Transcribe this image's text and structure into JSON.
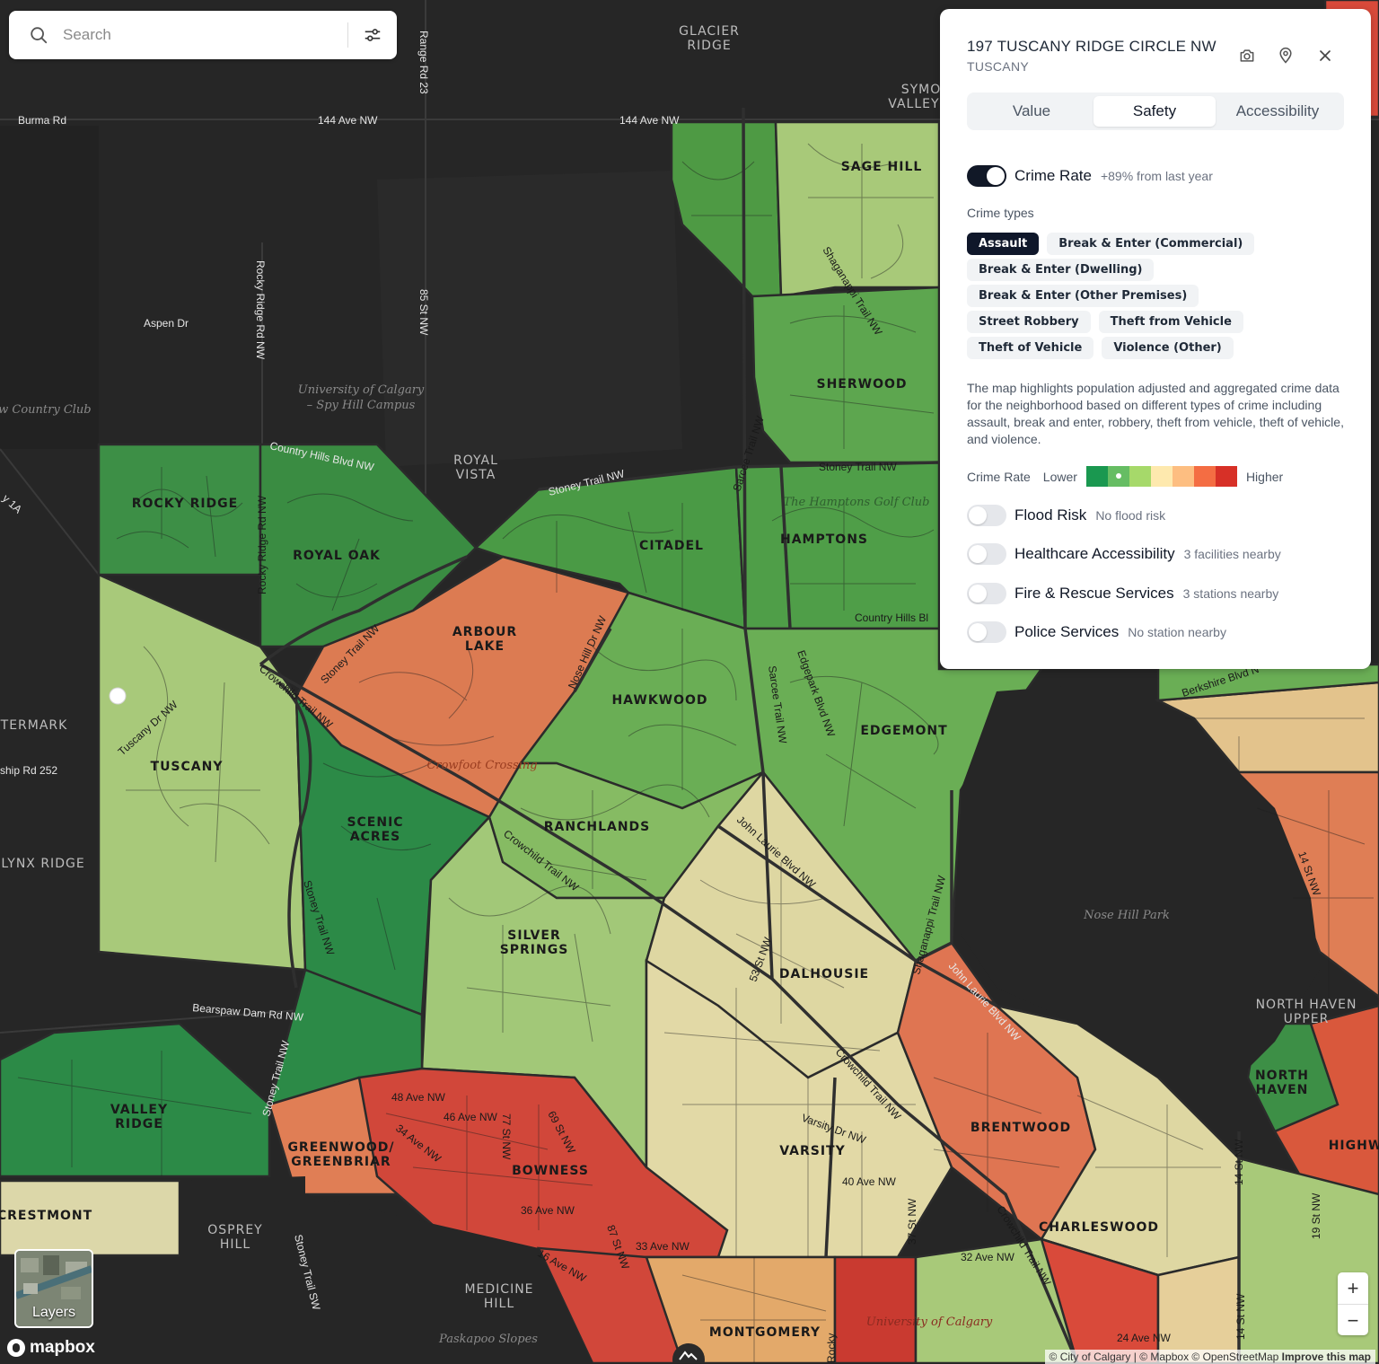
{
  "search": {
    "placeholder": "Search"
  },
  "panel": {
    "address": "197 TUSCANY RIDGE CIRCLE NW",
    "neighborhood": "TUSCANY",
    "tabs": [
      "Value",
      "Safety",
      "Accessibility"
    ],
    "active_tab": "Safety",
    "crime_rate": {
      "label": "Crime Rate",
      "note": "+89% from last year",
      "enabled": true
    },
    "crime_types_title": "Crime types",
    "crime_types": [
      {
        "label": "Assault",
        "selected": true
      },
      {
        "label": "Break & Enter (Commercial)",
        "selected": false
      },
      {
        "label": "Break & Enter (Dwelling)",
        "selected": false
      },
      {
        "label": "Break & Enter (Other Premises)",
        "selected": false
      },
      {
        "label": "Street Robbery",
        "selected": false
      },
      {
        "label": "Theft from Vehicle",
        "selected": false
      },
      {
        "label": "Theft of Vehicle",
        "selected": false
      },
      {
        "label": "Violence (Other)",
        "selected": false
      }
    ],
    "description": "The map highlights population adjusted and aggregated crime data for the neighborhood based on different types of crime including assault, break and enter, robbery, theft from vehicle, theft of vehicle, and violence.",
    "legend": {
      "title": "Crime Rate",
      "low": "Lower",
      "high": "Higher",
      "colors": [
        "#1a9850",
        "#66bd63",
        "#a6d96a",
        "#fee08b",
        "#fdae61",
        "#f46d43",
        "#d73027"
      ]
    },
    "layers": [
      {
        "label": "Flood Risk",
        "note": "No flood risk",
        "enabled": false
      },
      {
        "label": "Healthcare Accessibility",
        "note": "3 facilities nearby",
        "enabled": false
      },
      {
        "label": "Fire & Rescue Services",
        "note": "3 stations nearby",
        "enabled": false
      },
      {
        "label": "Police Services",
        "note": "No station nearby",
        "enabled": false
      }
    ]
  },
  "map": {
    "neighborhoods": [
      "SAGE HILL",
      "SHERWOOD",
      "ROCKY RIDGE",
      "ROYAL OAK",
      "CITADEL",
      "HAMPTONS",
      "ARBOUR",
      "LAKE",
      "HAWKWOOD",
      "EDGEMONT",
      "TUSCANY",
      "SCENIC",
      "ACRES",
      "RANCHLANDS",
      "SILVER",
      "SPRINGS",
      "DALHOUSIE",
      "VALLEY",
      "RIDGE",
      "GREENWOOD/",
      "GREENBRIAR",
      "BOWNESS",
      "BRENTWOOD",
      "VARSITY",
      "CHARLESWOOD",
      "NORTH",
      "HAVEN",
      "HIGHW",
      "CRESTMONT",
      "MONTGOMERY"
    ],
    "areas_dark": [
      "GLACIER",
      "RIDGE",
      "SYMO",
      "VALLEY R",
      "ROYAL",
      "VISTA",
      "TERMARK",
      "LYNX RIDGE",
      "OSPREY",
      "HILL",
      "MEDICINE",
      "HILL",
      "NORTH HAVEN",
      "UPPER"
    ],
    "places": [
      "University of Calgary",
      "– Spy Hill Campus",
      "The Hamptons Golf Club",
      "Crowfoot Crossing",
      "Nose Hill Park",
      "University of Calgary",
      "Paskapoo Slopes",
      "aw Country Club"
    ],
    "roads": [
      "Burma Rd",
      "144 Ave NW",
      "144 Ave NW",
      "Range Rd 23",
      "Aspen Dr",
      "Rocky Ridge Rd NW",
      "85 St NW",
      "Country Hills Blvd NW",
      "Stoney Trail NW",
      "Stoney Trail NW",
      "Sarcee Trail NW",
      "Shaganappi Trail NW",
      "Country Hills Bl",
      "Rocky Ridge Rd NW",
      "Stoney Trail NW",
      "Nose Hill Dr NW",
      "Crowchild Trail NW",
      "Tuscany Dr NW",
      "Sarcee Trail NW",
      "Edgepark Blvd NW",
      "ship Rd 252",
      "Crowchild Trail NW",
      "John Laurie Blvd NW",
      "Stoney Trail NW",
      "53 St NW",
      "Shaganappi Trail NW",
      "John Laurie Blvd NW",
      "Bearspaw Dam Rd NW",
      "Stoney Trail NW",
      "Crowchild Trail NW",
      "48 Ave NW",
      "46 Ave NW",
      "34 Ave NW",
      "77 St NW",
      "69 St NW",
      "Varsity Dr NW",
      "36 Ave NW",
      "33 Ave NW",
      "40 Ave NW",
      "37 St NW",
      "32 Ave NW",
      "Crowchild Trail NW",
      "14 St NW",
      "14 St NW",
      "19 St NW",
      "16 Ave NW",
      "Stoney Trail SW",
      "24 Ave NW",
      "14 St NW",
      "Berkshire Blvd N",
      "y 1A",
      "87 St NW",
      "Rocky"
    ]
  },
  "layers_button": "Layers",
  "zoom": {
    "in": "+",
    "out": "−"
  },
  "mapbox_logo": "mapbox",
  "attribution": "© City of Calgary | © Mapbox © OpenStreetMap",
  "improve": "Improve this map"
}
